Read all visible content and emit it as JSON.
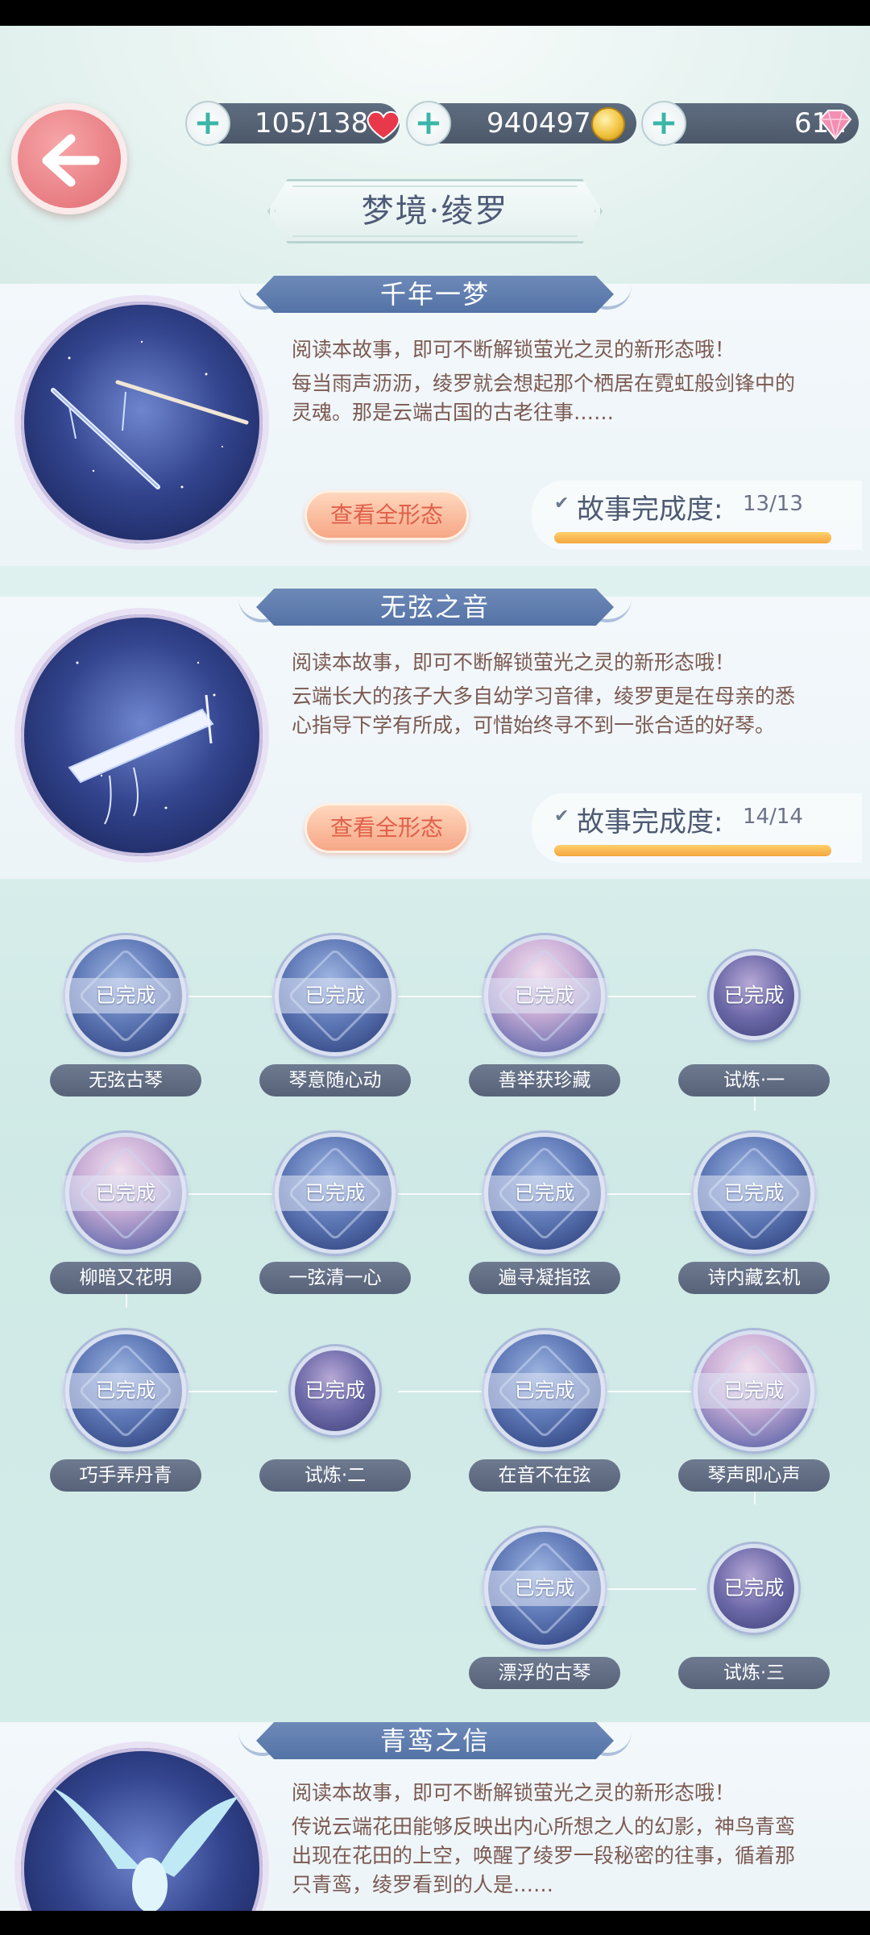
{
  "header": {
    "title": "梦境·绫罗",
    "resources": {
      "stamina": "105/138",
      "coins": "940497",
      "gems": "611"
    }
  },
  "stories": [
    {
      "title": "千年一梦",
      "intro": "阅读本故事，即可不断解锁萤光之灵的新形态哦！",
      "text": "每当雨声沥沥，绫罗就会想起那个栖居在霓虹般剑锋中的灵魂。那是云端古国的古老往事……",
      "button": "查看全形态",
      "progress_label": "故事完成度:",
      "progress_value": "13/13",
      "progress_fraction": 1.0
    },
    {
      "title": "无弦之音",
      "intro": "阅读本故事，即可不断解锁萤光之灵的新形态哦！",
      "text": "云端长大的孩子大多自幼学习音律，绫罗更是在母亲的悉心指导下学有所成，可惜始终寻不到一张合适的好琴。",
      "button": "查看全形态",
      "progress_label": "故事完成度:",
      "progress_value": "14/14",
      "progress_fraction": 1.0
    },
    {
      "title": "青鸾之信",
      "intro": "阅读本故事，即可不断解锁萤光之灵的新形态哦！",
      "text": "传说云端花田能够反映出内心所想之人的幻影，神鸟青鸾出现在花田的上空，唤醒了绫罗一段秘密的往事，循着那只青鸾，绫罗看到的人是……"
    }
  ],
  "chapters": [
    {
      "label": "无弦古琴",
      "status": "已完成"
    },
    {
      "label": "琴意随心动",
      "status": "已完成"
    },
    {
      "label": "善举获珍藏",
      "status": "已完成"
    },
    {
      "label": "试炼·一",
      "status": "已完成"
    },
    {
      "label": "柳暗又花明",
      "status": "已完成"
    },
    {
      "label": "一弦清一心",
      "status": "已完成"
    },
    {
      "label": "遍寻凝指弦",
      "status": "已完成"
    },
    {
      "label": "诗内藏玄机",
      "status": "已完成"
    },
    {
      "label": "巧手弄丹青",
      "status": "已完成"
    },
    {
      "label": "试炼·二",
      "status": "已完成"
    },
    {
      "label": "在音不在弦",
      "status": "已完成"
    },
    {
      "label": "琴声即心声",
      "status": "已完成"
    },
    {
      "label": "漂浮的古琴",
      "status": "已完成"
    },
    {
      "label": "试炼·三",
      "status": "已完成"
    }
  ],
  "colors": {
    "accent": "#e77d82",
    "ribbon": "#5f7cb0",
    "progress": "#f4a640"
  }
}
